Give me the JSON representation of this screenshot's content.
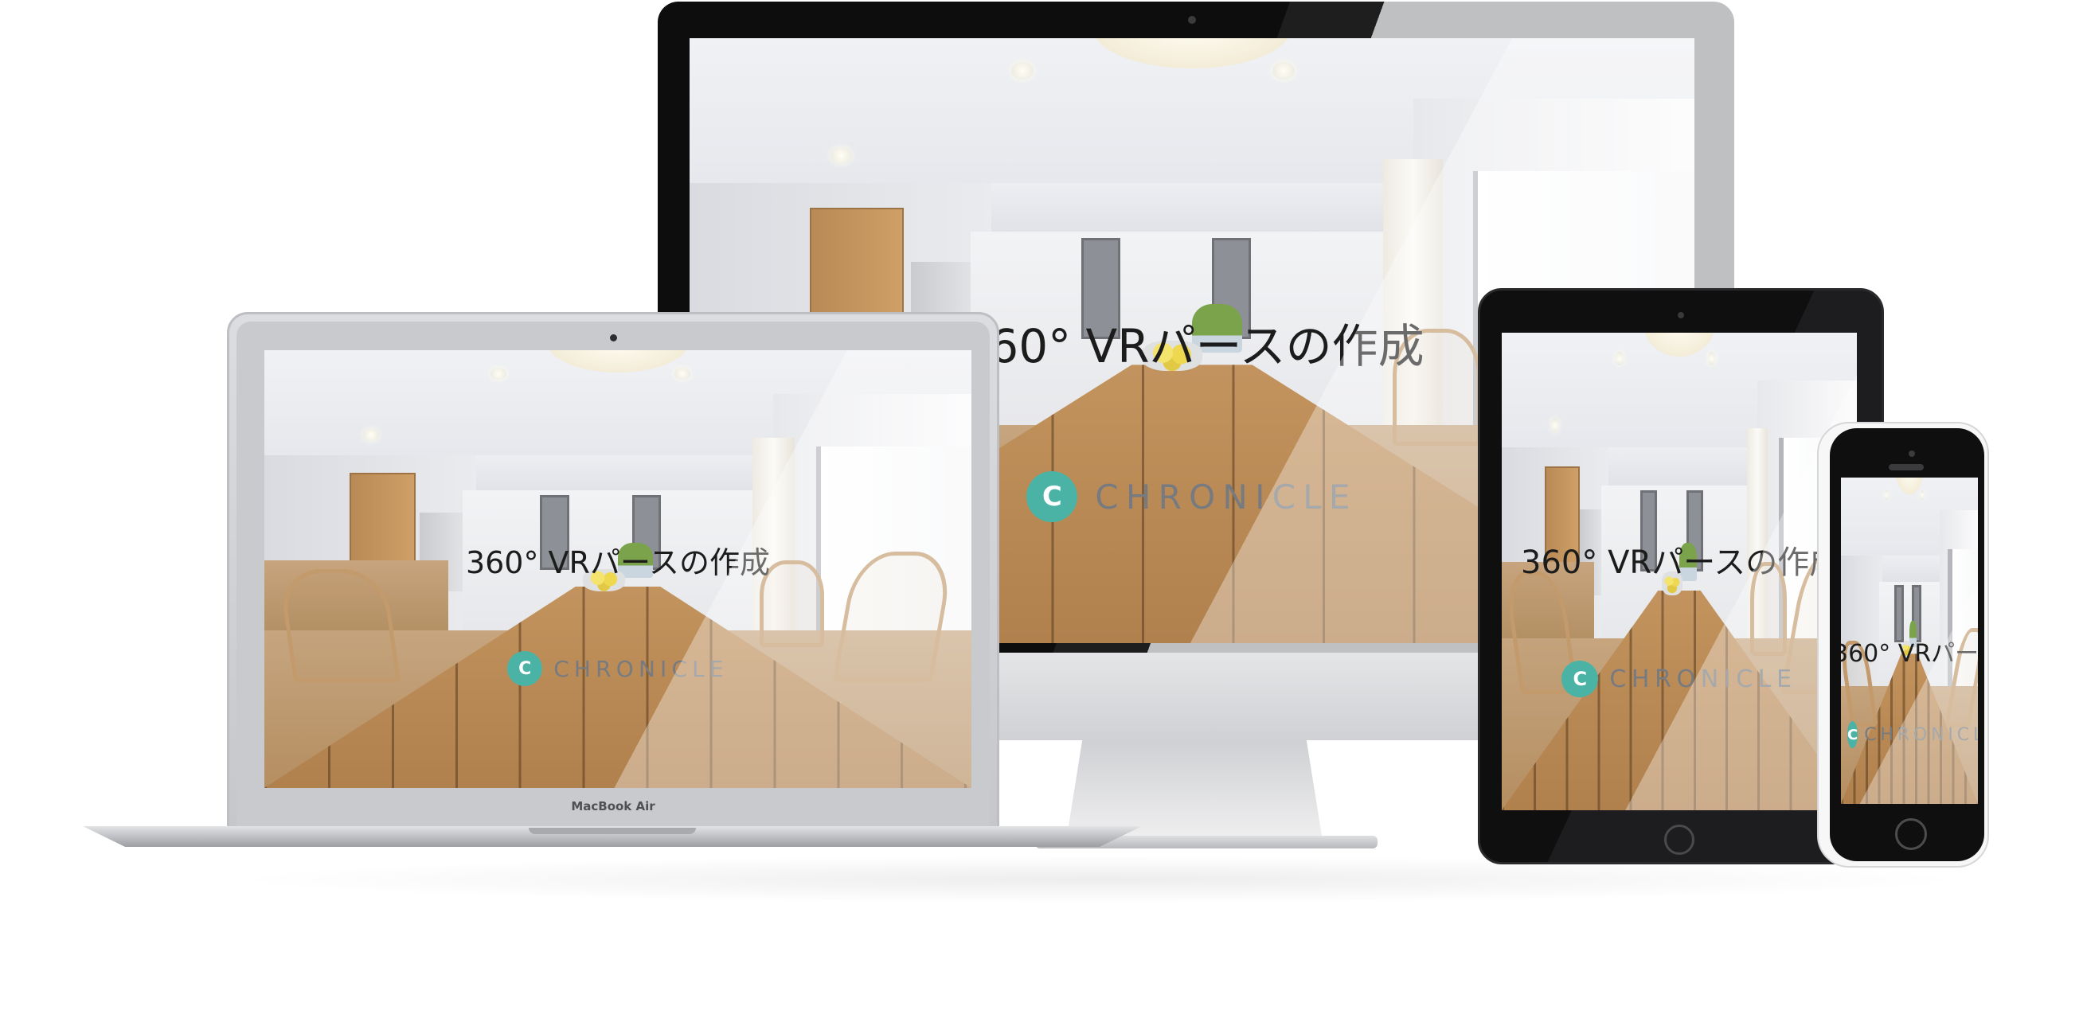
{
  "headline": "360° VRパースの作成",
  "brand": {
    "name": "CHRONICLE",
    "logo_mark": "C",
    "accent_color": "#4ab3a6"
  },
  "devices": {
    "laptop_label": "MacBook Air"
  },
  "icons": {
    "brand_logo": "circular-arrow-logo-icon",
    "camera": "camera-icon",
    "home_button": "home-button-icon"
  }
}
